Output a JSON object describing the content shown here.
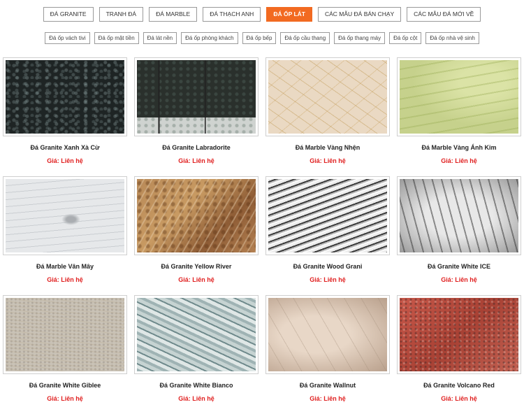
{
  "tabs": [
    {
      "label": "ĐÁ GRANITE",
      "active": false
    },
    {
      "label": "TRANH ĐÁ",
      "active": false
    },
    {
      "label": "ĐÁ MARBLE",
      "active": false
    },
    {
      "label": "ĐÁ THẠCH ANH",
      "active": false
    },
    {
      "label": "ĐÁ ỐP LÁT",
      "active": true
    },
    {
      "label": "CÁC MẪU ĐÁ BÁN CHẠY",
      "active": false
    },
    {
      "label": "CÁC MẪU ĐÁ MỚI VỀ",
      "active": false
    }
  ],
  "subtabs": [
    "Đá ốp vách tivi",
    "Đá ốp mặt tiền",
    "Đá lát nền",
    "Đá ốp phòng khách",
    "Đá ốp bếp",
    "Đá ốp cầu thang",
    "Đá ốp thang máy",
    "Đá ốp cột",
    "Đá ốp nhà vệ sinh"
  ],
  "accent_color": "#f26a21",
  "price_color": "#e02020",
  "products": [
    {
      "name": "Đá Granite Xanh Xà Cừ",
      "price": "Giá: Liên hệ",
      "texture": "s-xanh"
    },
    {
      "name": "Đá Granite Labradorite",
      "price": "Giá: Liên hệ",
      "texture": "s-labra"
    },
    {
      "name": "Đá Marble Vàng Nhện",
      "price": "Giá: Liên hệ",
      "texture": "s-nhen"
    },
    {
      "name": "Đá Marble Vàng Ánh Kim",
      "price": "Giá: Liên hệ",
      "texture": "s-anhkim"
    },
    {
      "name": "Đá Marble Vân Mây",
      "price": "Giá: Liên hệ",
      "texture": "s-vanmay"
    },
    {
      "name": "Đá Granite Yellow River",
      "price": "Giá: Liên hệ",
      "texture": "s-yellow"
    },
    {
      "name": "Đá Granite Wood Grani",
      "price": "Giá: Liên hệ",
      "texture": "s-wood"
    },
    {
      "name": "Đá Granite White ICE",
      "price": "Giá: Liên hệ",
      "texture": "s-ice"
    },
    {
      "name": "Đá Granite White Giblee",
      "price": "Giá: Liên hệ",
      "texture": "s-giblee"
    },
    {
      "name": "Đá Granite White Bianco",
      "price": "Giá: Liên hệ",
      "texture": "s-bianco"
    },
    {
      "name": "Đá Granite Wallnut",
      "price": "Giá: Liên hệ",
      "texture": "s-wallnut"
    },
    {
      "name": "Đá Granite Volcano Red",
      "price": "Giá: Liên hệ",
      "texture": "s-volcano"
    }
  ]
}
